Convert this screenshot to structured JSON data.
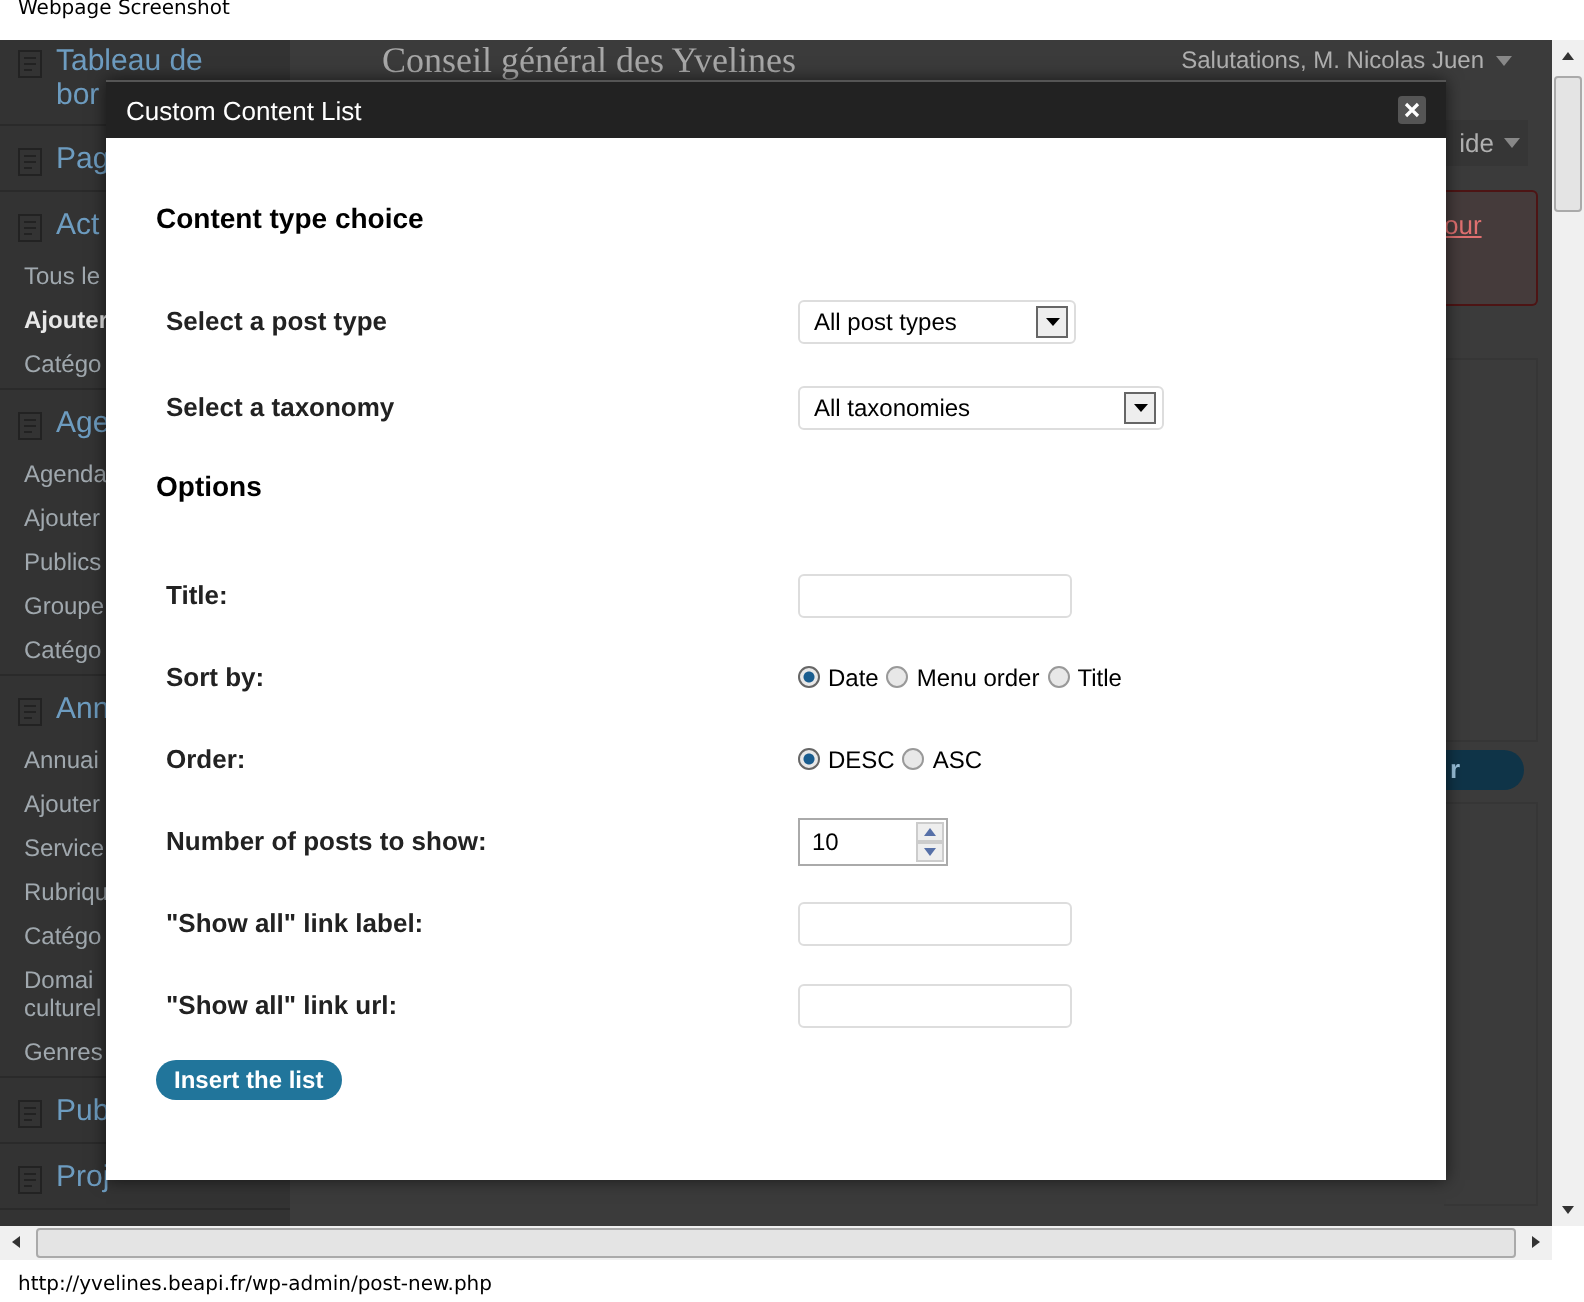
{
  "caption": "Webpage Screenshot",
  "sidebar": {
    "items": [
      {
        "label": "Tableau de bor"
      },
      {
        "label": "Pag"
      },
      {
        "label": "Act",
        "children": [
          {
            "label": "Tous le",
            "current": false
          },
          {
            "label": "Ajouter",
            "current": true
          },
          {
            "label": "Catégo",
            "current": false
          }
        ]
      },
      {
        "label": "Age",
        "children": [
          {
            "label": "Agenda",
            "current": false
          },
          {
            "label": "Ajouter",
            "current": false
          },
          {
            "label": "Publics",
            "current": false
          },
          {
            "label": "Groupe",
            "current": false
          },
          {
            "label": "Catégo",
            "current": false
          }
        ]
      },
      {
        "label": "Ann",
        "children": [
          {
            "label": "Annuai",
            "current": false
          },
          {
            "label": "Ajouter",
            "current": false
          },
          {
            "label": "Service",
            "current": false
          },
          {
            "label": "Rubriqu",
            "current": false
          },
          {
            "label": "Catégo",
            "current": false
          },
          {
            "label": "Domai culturel",
            "current": false
          },
          {
            "label": "Genres",
            "current": false
          }
        ]
      },
      {
        "label": "Pub"
      },
      {
        "label": "Proj"
      }
    ]
  },
  "header": {
    "site_title": "Conseil général des Yvelines",
    "greeting": "Salutations, M. Nicolas Juen",
    "help_tab": "ide"
  },
  "notice": {
    "link": "our"
  },
  "side_button": {
    "label": "r"
  },
  "modal": {
    "title": "Custom Content List",
    "sections": [
      {
        "heading": "Content type choice",
        "fields": [
          {
            "kind": "select",
            "label": "Select a post type",
            "value": "All post types"
          },
          {
            "kind": "select",
            "label": "Select a taxonomy",
            "value": "All taxonomies"
          }
        ]
      },
      {
        "heading": "Options",
        "fields": [
          {
            "kind": "text",
            "label": "Title:"
          },
          {
            "kind": "radio",
            "label": "Sort by:",
            "options": [
              {
                "label": "Date",
                "selected": true
              },
              {
                "label": "Menu order",
                "selected": false
              },
              {
                "label": "Title",
                "selected": false
              }
            ]
          },
          {
            "kind": "radio",
            "label": "Order:",
            "options": [
              {
                "label": "DESC",
                "selected": true
              },
              {
                "label": "ASC",
                "selected": false
              }
            ]
          },
          {
            "kind": "number",
            "label": "Number of posts to show:",
            "value": "10"
          },
          {
            "kind": "text",
            "label": "\"Show all\" link label:"
          },
          {
            "kind": "text",
            "label": "\"Show all\" link url:"
          }
        ]
      }
    ],
    "submit": "Insert the list"
  },
  "status_bar": {
    "url": "http://yvelines.beapi.fr/wp-admin/post-new.php"
  }
}
